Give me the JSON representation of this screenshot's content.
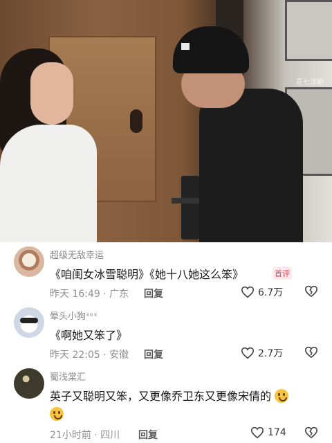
{
  "video": {
    "watermark": "花七洋剧"
  },
  "comments": [
    {
      "username": "超级无敌幸运",
      "content": "《咱闺女冰雪聪明》《她十八她这么笨》",
      "badge": "首评",
      "meta": "昨天 16:49 · 广东",
      "reply_label": "回复",
      "likes": "6.7万"
    },
    {
      "username": "晕头小狗ˣᵒˣ",
      "content": "《啊她又笨了》",
      "meta": "昨天 22:05 · 安徽",
      "reply_label": "回复",
      "likes": "2.7万"
    },
    {
      "username": "蜀浅棠汇",
      "content": "英子又聪明又笨，又更像乔卫东又更像宋倩的",
      "meta": "21小时前 · 四川",
      "reply_label": "回复",
      "likes": "174"
    }
  ],
  "colors": {
    "badge_text": "#e0425a",
    "badge_bg": "#fde9ec",
    "username": "#8a8a8a",
    "meta": "#8f8f8f"
  }
}
